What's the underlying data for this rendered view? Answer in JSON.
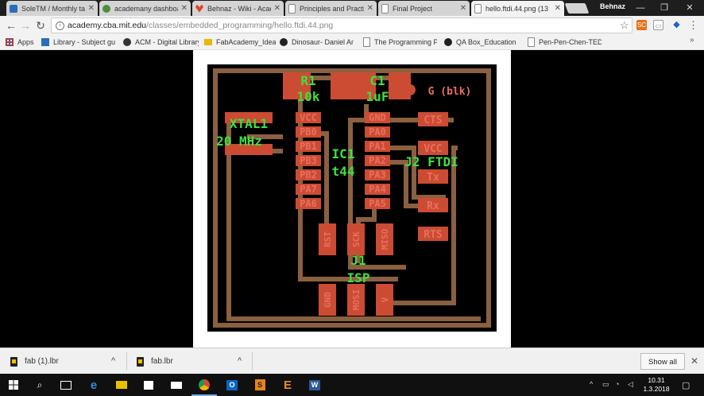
{
  "browser": {
    "tabs": [
      {
        "title": "SoleTM / Monthly ta",
        "active": false,
        "icon": "document-icon",
        "color": "#2a6ebb"
      },
      {
        "title": "academany dashboa",
        "active": false,
        "icon": "globe-icon",
        "color": "#4a8f3a"
      },
      {
        "title": "Behnaz - Wiki - Acad",
        "active": false,
        "icon": "gitlab-icon",
        "color": "#e2432a"
      },
      {
        "title": "Principles and Practi",
        "active": false,
        "icon": "page-icon",
        "color": "#888888"
      },
      {
        "title": "Final Project",
        "active": false,
        "icon": "page-icon",
        "color": "#888888"
      },
      {
        "title": "hello.ftdi.44.png (13",
        "active": true,
        "icon": "page-icon",
        "color": "#888888"
      }
    ],
    "user_badge": "Behnaz",
    "window_controls": {
      "minimize": "—",
      "restore": "❐",
      "close": "✕"
    },
    "address": {
      "host": "academy.cba.mit.edu",
      "path": "/classes/embedded_programming/hello.ftdi.44.png"
    },
    "extensions": [
      {
        "label": "SC",
        "color": "#e8711a"
      },
      {
        "label": "▭",
        "color": "#777777"
      },
      {
        "label": "◆",
        "color": "#1b64c8"
      },
      {
        "label": "⋮",
        "color": "#555555"
      }
    ],
    "bookmarks": [
      {
        "label": "Apps",
        "icon": "apps-grid-icon",
        "color": "#c0392b"
      },
      {
        "label": "Library - Subject guic",
        "icon": "library-icon",
        "color": "#2a6ebb"
      },
      {
        "label": "ACM - Digital Library",
        "icon": "acm-icon",
        "color": "#333333"
      },
      {
        "label": "FabAcademy_Ideas",
        "icon": "folder-icon",
        "color": "#e6b800"
      },
      {
        "label": "Dinosaur- Daniel Am",
        "icon": "github-icon",
        "color": "#222222"
      },
      {
        "label": "The Programming Pu",
        "icon": "page-icon",
        "color": "#888888"
      },
      {
        "label": "QA Box_Educational",
        "icon": "github-icon",
        "color": "#222222"
      },
      {
        "label": "Pen-Pen-Chen-TED-l",
        "icon": "page-icon",
        "color": "#888888"
      }
    ]
  },
  "board": {
    "labels": {
      "r1": "R1",
      "r1_val": "10k",
      "c1": "C1",
      "c1_val": "1uF",
      "gblk": "G (blk)",
      "xtal": "XTAL1",
      "xtal_val": "20 MHz",
      "ic": "IC1",
      "ic_val": "t44",
      "ftdi": "J2 FTDI",
      "isp": "J1",
      "isp_val": "ISP"
    },
    "left_pins": [
      "VCC",
      "PB0",
      "PB1",
      "PB3",
      "PB2",
      "PA7",
      "PA6"
    ],
    "right_pins": [
      "GND",
      "PA0",
      "PA1",
      "PA2",
      "PA3",
      "PA4",
      "PA5"
    ],
    "ftdi_pins": [
      "CTS",
      "VCC",
      "Tx",
      "Rx",
      "RTS"
    ],
    "isp_pins_top": [
      "RST",
      "SCK",
      "MISO"
    ],
    "isp_pins_bottom": [
      "GND",
      "MOSI",
      "V"
    ],
    "colors": {
      "trace": "#8a6040",
      "pad": "#cc4b33",
      "label": "#3ee13e",
      "pinText": "#e87060",
      "bg": "#000000"
    }
  },
  "downloads": {
    "items": [
      {
        "name": "fab (1).lbr"
      },
      {
        "name": "fab.lbr"
      }
    ],
    "show_all": "Show all",
    "close": "✕"
  },
  "taskbar": {
    "clock_time": "10.31",
    "clock_date": "1.3.2018"
  }
}
